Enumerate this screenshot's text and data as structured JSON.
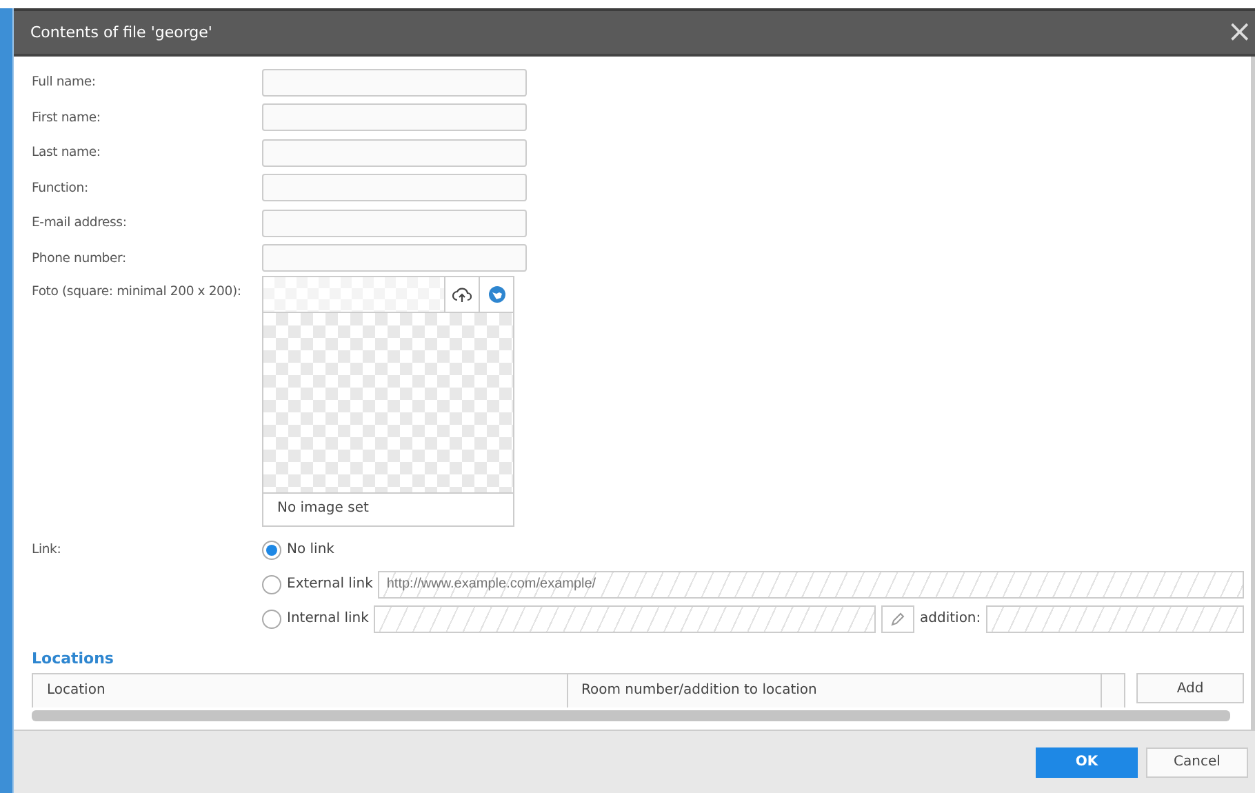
{
  "dialog": {
    "title": "Contents of file 'george'",
    "close": "×"
  },
  "fields": [
    {
      "label": "Full name:"
    },
    {
      "label": "First name:"
    },
    {
      "label": "Last name:"
    },
    {
      "label": "Function:"
    },
    {
      "label": "E-mail address:"
    },
    {
      "label": "Phone number:"
    }
  ],
  "photo": {
    "label": "Foto (square: minimal 200 x 200):",
    "status": "No image set"
  },
  "link": {
    "label": "Link:",
    "options": [
      {
        "kind": "none",
        "label": "No link",
        "selected": true
      },
      {
        "kind": "external",
        "label": "External link",
        "selected": false,
        "placeholder": "http://www.example.com/example/"
      },
      {
        "kind": "internal",
        "label": "Internal link",
        "selected": false,
        "addition_label": "addition:"
      }
    ]
  },
  "locations": {
    "heading": "Locations",
    "columns": [
      "Location",
      "Room number/addition to location"
    ],
    "add_button": "Add"
  },
  "buttons": [
    {
      "kind": "primary",
      "label": "OK"
    },
    {
      "kind": "secondary",
      "label": "Cancel"
    }
  ]
}
